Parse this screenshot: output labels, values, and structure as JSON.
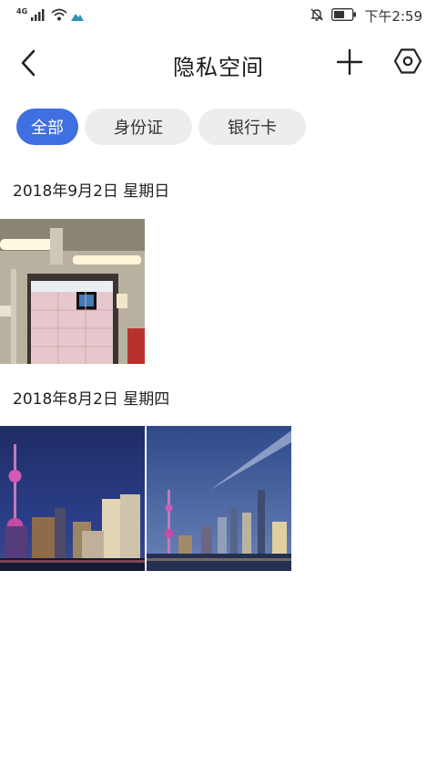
{
  "status_bar": {
    "network": "4G",
    "time": "下午2:59"
  },
  "header": {
    "title": "隐私空间"
  },
  "tabs": [
    {
      "label": "全部",
      "active": true
    },
    {
      "label": "身份证",
      "active": false
    },
    {
      "label": "银行卡",
      "active": false
    }
  ],
  "groups": [
    {
      "date": "2018年9月2日 星期日",
      "photos": [
        "subway-car-interior"
      ]
    },
    {
      "date": "2018年8月2日 星期四",
      "photos": [
        "shanghai-skyline-night-1",
        "shanghai-skyline-night-2"
      ]
    }
  ],
  "colors": {
    "accent": "#3f6fe0",
    "chip_bg": "#ededed"
  }
}
